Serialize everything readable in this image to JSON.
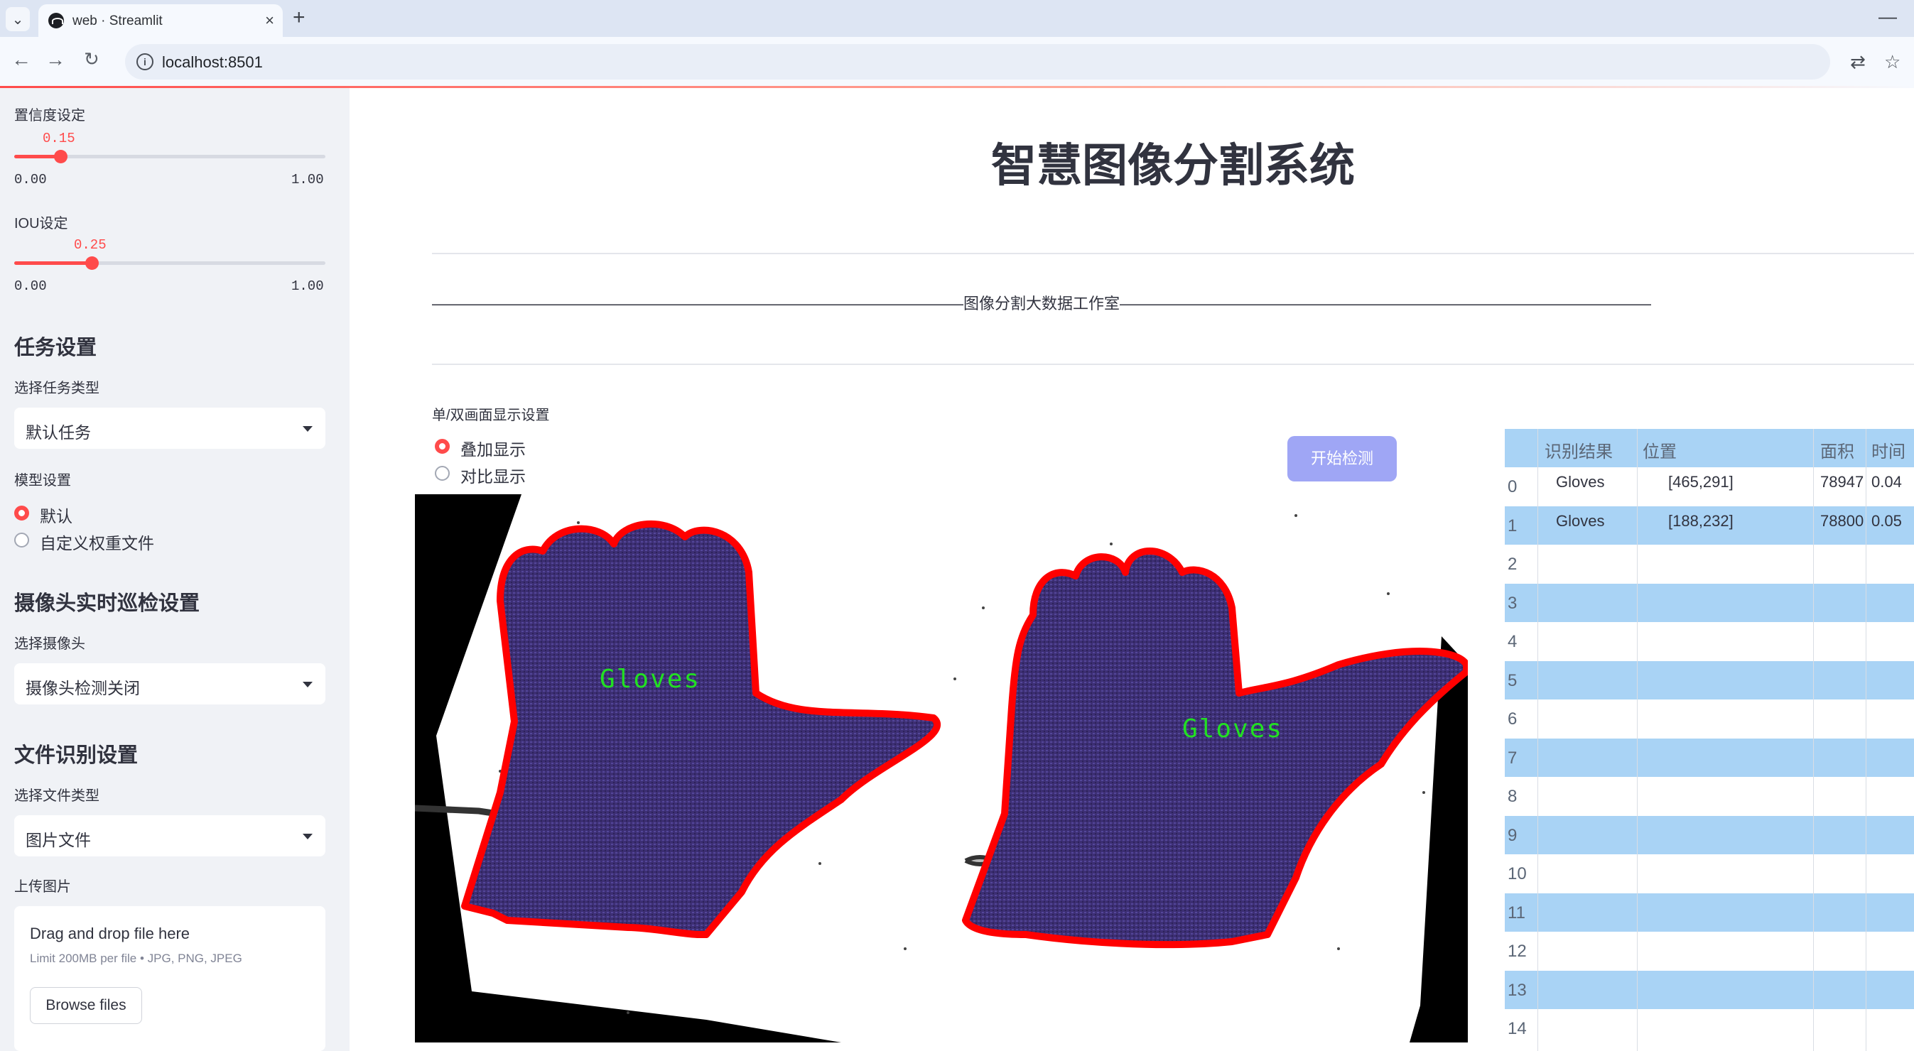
{
  "browser": {
    "tab_title": "web · Streamlit",
    "url": "localhost:8501",
    "tab_close": "×",
    "new_tab": "+",
    "minimize": "—"
  },
  "sidebar": {
    "confidence": {
      "label": "置信度设定",
      "value": "0.15",
      "value_fraction": 0.15,
      "min": "0.00",
      "max": "1.00"
    },
    "iou": {
      "label": "IOU设定",
      "value": "0.25",
      "value_fraction": 0.25,
      "min": "0.00",
      "max": "1.00"
    },
    "task_header": "任务设置",
    "task_type_label": "选择任务类型",
    "task_type_value": "默认任务",
    "model_label": "模型设置",
    "model_options": [
      "默认",
      "自定义权重文件"
    ],
    "model_selected": 0,
    "camera_header": "摄像头实时巡检设置",
    "camera_label": "选择摄像头",
    "camera_value": "摄像头检测关闭",
    "file_header": "文件识别设置",
    "file_type_label": "选择文件类型",
    "file_type_value": "图片文件",
    "upload_label": "上传图片",
    "upload": {
      "title": "Drag and drop file here",
      "subtitle": "Limit 200MB per file • JPG, PNG, JPEG",
      "button": "Browse files"
    }
  },
  "main": {
    "title": "智慧图像分割系统",
    "divider_text": "——————————————————————————————————图像分割大数据工作室——————————————————————————————————",
    "display_mode_label": "单/双画面显示设置",
    "display_options": [
      "叠加显示",
      "对比显示"
    ],
    "display_selected": 0,
    "start_button": "开始检测",
    "image_labels": [
      "Gloves",
      "Gloves"
    ]
  },
  "results_table": {
    "columns": [
      "识别结果",
      "位置",
      "面积",
      "时间"
    ],
    "rows": [
      {
        "index": "0",
        "result": "Gloves",
        "position": "[465,291]",
        "area": "78947",
        "time": "0.04"
      },
      {
        "index": "1",
        "result": "Gloves",
        "position": "[188,232]",
        "area": "78800",
        "time": "0.05"
      },
      {
        "index": "2",
        "result": "",
        "position": "",
        "area": "",
        "time": ""
      },
      {
        "index": "3",
        "result": "",
        "position": "",
        "area": "",
        "time": ""
      },
      {
        "index": "4",
        "result": "",
        "position": "",
        "area": "",
        "time": ""
      },
      {
        "index": "5",
        "result": "",
        "position": "",
        "area": "",
        "time": ""
      },
      {
        "index": "6",
        "result": "",
        "position": "",
        "area": "",
        "time": ""
      },
      {
        "index": "7",
        "result": "",
        "position": "",
        "area": "",
        "time": ""
      },
      {
        "index": "8",
        "result": "",
        "position": "",
        "area": "",
        "time": ""
      },
      {
        "index": "9",
        "result": "",
        "position": "",
        "area": "",
        "time": ""
      },
      {
        "index": "10",
        "result": "",
        "position": "",
        "area": "",
        "time": ""
      },
      {
        "index": "11",
        "result": "",
        "position": "",
        "area": "",
        "time": ""
      },
      {
        "index": "12",
        "result": "",
        "position": "",
        "area": "",
        "time": ""
      },
      {
        "index": "13",
        "result": "",
        "position": "",
        "area": "",
        "time": ""
      },
      {
        "index": "14",
        "result": "",
        "position": "",
        "area": "",
        "time": ""
      }
    ]
  },
  "colors": {
    "accent": "#ff4b4b",
    "sidebar_bg": "#f0f2f6",
    "button_bg": "#9fa6f5",
    "table_stripe": "#a9d3f5",
    "mask_fill": "#3d2f74",
    "mask_outline": "#ff0000",
    "label_text": "#22e022"
  }
}
